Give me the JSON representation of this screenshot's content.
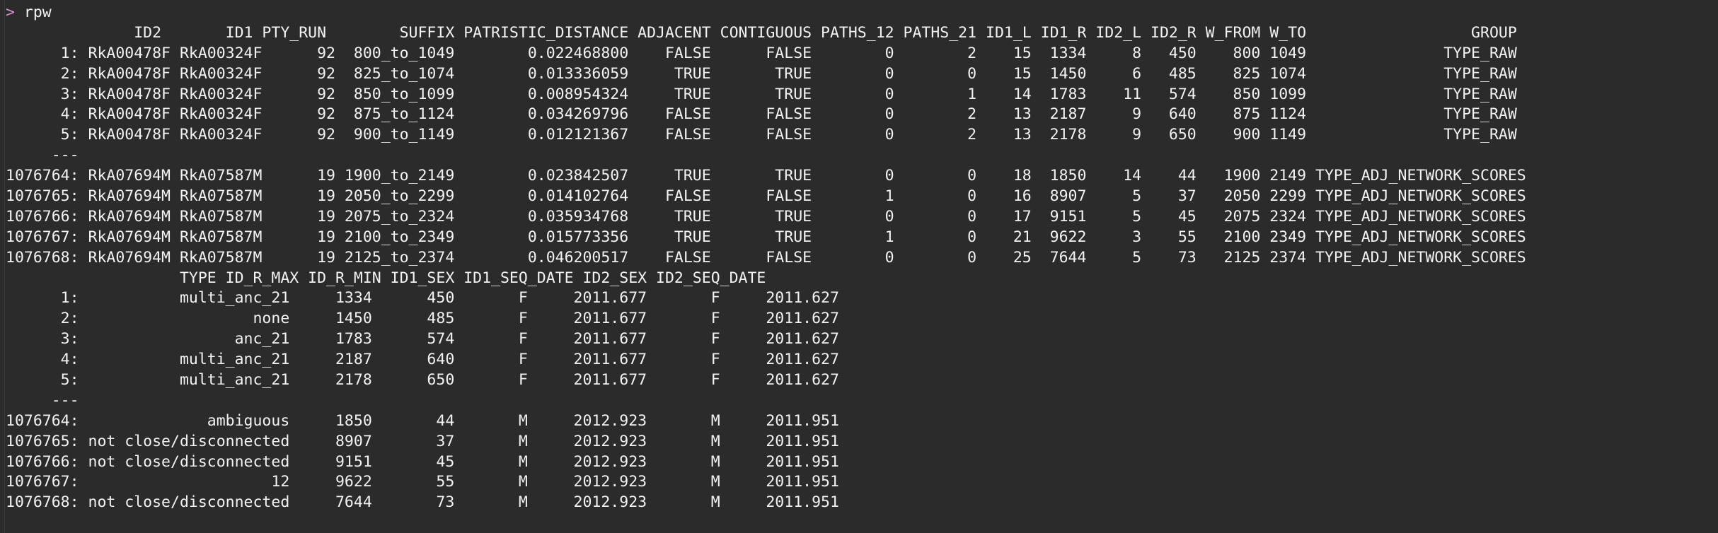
{
  "terminal": {
    "prompt_symbol": ">",
    "command": "rpw",
    "separator": "---",
    "colors": {
      "background": "#2b2b2b",
      "text": "#f2f2f2",
      "prompt": "#d98fd0"
    }
  },
  "table_main": {
    "columns": [
      "ID2",
      "ID1",
      "PTY_RUN",
      "SUFFIX",
      "PATRISTIC_DISTANCE",
      "ADJACENT",
      "CONTIGUOUS",
      "PATHS_12",
      "PATHS_21",
      "ID1_L",
      "ID1_R",
      "ID2_L",
      "ID2_R",
      "W_FROM",
      "W_TO",
      "GROUP"
    ],
    "header_line": "              ID2        ID1 PTY_RUN        SUFFIX PATRISTIC_DISTANCE ADJACENT CONTIGUOUS PATHS_12 PATHS_21 ID1_L ID1_R ID2_L ID2_R W_FROM W_TO                  GROUP",
    "rows_top": [
      {
        "index": "1:",
        "ID2": "RkA00478F",
        "ID1": "RkA00324F",
        "PTY_RUN": "92",
        "SUFFIX": "800_to_1049",
        "PATRISTIC_DISTANCE": "0.022468800",
        "ADJACENT": "FALSE",
        "CONTIGUOUS": "FALSE",
        "PATHS_12": "0",
        "PATHS_21": "2",
        "ID1_L": "15",
        "ID1_R": "1334",
        "ID2_L": "8",
        "ID2_R": "450",
        "W_FROM": "800",
        "W_TO": "1049",
        "GROUP": "TYPE_RAW"
      },
      {
        "index": "2:",
        "ID2": "RkA00478F",
        "ID1": "RkA00324F",
        "PTY_RUN": "92",
        "SUFFIX": "825_to_1074",
        "PATRISTIC_DISTANCE": "0.013336059",
        "ADJACENT": "TRUE",
        "CONTIGUOUS": "TRUE",
        "PATHS_12": "0",
        "PATHS_21": "0",
        "ID1_L": "15",
        "ID1_R": "1450",
        "ID2_L": "6",
        "ID2_R": "485",
        "W_FROM": "825",
        "W_TO": "1074",
        "GROUP": "TYPE_RAW"
      },
      {
        "index": "3:",
        "ID2": "RkA00478F",
        "ID1": "RkA00324F",
        "PTY_RUN": "92",
        "SUFFIX": "850_to_1099",
        "PATRISTIC_DISTANCE": "0.008954324",
        "ADJACENT": "TRUE",
        "CONTIGUOUS": "TRUE",
        "PATHS_12": "0",
        "PATHS_21": "1",
        "ID1_L": "14",
        "ID1_R": "1783",
        "ID2_L": "11",
        "ID2_R": "574",
        "W_FROM": "850",
        "W_TO": "1099",
        "GROUP": "TYPE_RAW"
      },
      {
        "index": "4:",
        "ID2": "RkA00478F",
        "ID1": "RkA00324F",
        "PTY_RUN": "92",
        "SUFFIX": "875_to_1124",
        "PATRISTIC_DISTANCE": "0.034269796",
        "ADJACENT": "FALSE",
        "CONTIGUOUS": "FALSE",
        "PATHS_12": "0",
        "PATHS_21": "2",
        "ID1_L": "13",
        "ID1_R": "2187",
        "ID2_L": "9",
        "ID2_R": "640",
        "W_FROM": "875",
        "W_TO": "1124",
        "GROUP": "TYPE_RAW"
      },
      {
        "index": "5:",
        "ID2": "RkA00478F",
        "ID1": "RkA00324F",
        "PTY_RUN": "92",
        "SUFFIX": "900_to_1149",
        "PATRISTIC_DISTANCE": "0.012121367",
        "ADJACENT": "FALSE",
        "CONTIGUOUS": "FALSE",
        "PATHS_12": "0",
        "PATHS_21": "2",
        "ID1_L": "13",
        "ID1_R": "2178",
        "ID2_L": "9",
        "ID2_R": "650",
        "W_FROM": "900",
        "W_TO": "1149",
        "GROUP": "TYPE_RAW"
      }
    ],
    "rows_bottom": [
      {
        "index": "1076764:",
        "ID2": "RkA07694M",
        "ID1": "RkA07587M",
        "PTY_RUN": "19",
        "SUFFIX": "1900_to_2149",
        "PATRISTIC_DISTANCE": "0.023842507",
        "ADJACENT": "TRUE",
        "CONTIGUOUS": "TRUE",
        "PATHS_12": "0",
        "PATHS_21": "0",
        "ID1_L": "18",
        "ID1_R": "1850",
        "ID2_L": "14",
        "ID2_R": "44",
        "W_FROM": "1900",
        "W_TO": "2149",
        "GROUP": "TYPE_ADJ_NETWORK_SCORES"
      },
      {
        "index": "1076765:",
        "ID2": "RkA07694M",
        "ID1": "RkA07587M",
        "PTY_RUN": "19",
        "SUFFIX": "2050_to_2299",
        "PATRISTIC_DISTANCE": "0.014102764",
        "ADJACENT": "FALSE",
        "CONTIGUOUS": "FALSE",
        "PATHS_12": "1",
        "PATHS_21": "0",
        "ID1_L": "16",
        "ID1_R": "8907",
        "ID2_L": "5",
        "ID2_R": "37",
        "W_FROM": "2050",
        "W_TO": "2299",
        "GROUP": "TYPE_ADJ_NETWORK_SCORES"
      },
      {
        "index": "1076766:",
        "ID2": "RkA07694M",
        "ID1": "RkA07587M",
        "PTY_RUN": "19",
        "SUFFIX": "2075_to_2324",
        "PATRISTIC_DISTANCE": "0.035934768",
        "ADJACENT": "TRUE",
        "CONTIGUOUS": "TRUE",
        "PATHS_12": "0",
        "PATHS_21": "0",
        "ID1_L": "17",
        "ID1_R": "9151",
        "ID2_L": "5",
        "ID2_R": "45",
        "W_FROM": "2075",
        "W_TO": "2324",
        "GROUP": "TYPE_ADJ_NETWORK_SCORES"
      },
      {
        "index": "1076767:",
        "ID2": "RkA07694M",
        "ID1": "RkA07587M",
        "PTY_RUN": "19",
        "SUFFIX": "2100_to_2349",
        "PATRISTIC_DISTANCE": "0.015773356",
        "ADJACENT": "TRUE",
        "CONTIGUOUS": "TRUE",
        "PATHS_12": "1",
        "PATHS_21": "0",
        "ID1_L": "21",
        "ID1_R": "9622",
        "ID2_L": "3",
        "ID2_R": "55",
        "W_FROM": "2100",
        "W_TO": "2349",
        "GROUP": "TYPE_ADJ_NETWORK_SCORES"
      },
      {
        "index": "1076768:",
        "ID2": "RkA07694M",
        "ID1": "RkA07587M",
        "PTY_RUN": "19",
        "SUFFIX": "2125_to_2374",
        "PATRISTIC_DISTANCE": "0.046200517",
        "ADJACENT": "FALSE",
        "CONTIGUOUS": "FALSE",
        "PATHS_12": "0",
        "PATHS_21": "0",
        "ID1_L": "25",
        "ID1_R": "7644",
        "ID2_L": "5",
        "ID2_R": "73",
        "W_FROM": "2125",
        "W_TO": "2374",
        "GROUP": "TYPE_ADJ_NETWORK_SCORES"
      }
    ]
  },
  "table_cont": {
    "columns": [
      "TYPE",
      "ID_R_MAX",
      "ID_R_MIN",
      "ID1_SEX",
      "ID1_SEQ_DATE",
      "ID2_SEX",
      "ID2_SEQ_DATE"
    ],
    "header_line": "                    TYPE ID_R_MAX ID_R_MIN ID1_SEX ID1_SEQ_DATE ID2_SEX ID2_SEQ_DATE",
    "rows_top": [
      {
        "index": "1:",
        "TYPE": "multi_anc_21",
        "ID_R_MAX": "1334",
        "ID_R_MIN": "450",
        "ID1_SEX": "F",
        "ID1_SEQ_DATE": "2011.677",
        "ID2_SEX": "F",
        "ID2_SEQ_DATE": "2011.627"
      },
      {
        "index": "2:",
        "TYPE": "none",
        "ID_R_MAX": "1450",
        "ID_R_MIN": "485",
        "ID1_SEX": "F",
        "ID1_SEQ_DATE": "2011.677",
        "ID2_SEX": "F",
        "ID2_SEQ_DATE": "2011.627"
      },
      {
        "index": "3:",
        "TYPE": "anc_21",
        "ID_R_MAX": "1783",
        "ID_R_MIN": "574",
        "ID1_SEX": "F",
        "ID1_SEQ_DATE": "2011.677",
        "ID2_SEX": "F",
        "ID2_SEQ_DATE": "2011.627"
      },
      {
        "index": "4:",
        "TYPE": "multi_anc_21",
        "ID_R_MAX": "2187",
        "ID_R_MIN": "640",
        "ID1_SEX": "F",
        "ID1_SEQ_DATE": "2011.677",
        "ID2_SEX": "F",
        "ID2_SEQ_DATE": "2011.627"
      },
      {
        "index": "5:",
        "TYPE": "multi_anc_21",
        "ID_R_MAX": "2178",
        "ID_R_MIN": "650",
        "ID1_SEX": "F",
        "ID1_SEQ_DATE": "2011.677",
        "ID2_SEX": "F",
        "ID2_SEQ_DATE": "2011.627"
      }
    ],
    "rows_bottom": [
      {
        "index": "1076764:",
        "TYPE": "ambiguous",
        "ID_R_MAX": "1850",
        "ID_R_MIN": "44",
        "ID1_SEX": "M",
        "ID1_SEQ_DATE": "2012.923",
        "ID2_SEX": "M",
        "ID2_SEQ_DATE": "2011.951"
      },
      {
        "index": "1076765:",
        "TYPE": "not close/disconnected",
        "ID_R_MAX": "8907",
        "ID_R_MIN": "37",
        "ID1_SEX": "M",
        "ID1_SEQ_DATE": "2012.923",
        "ID2_SEX": "M",
        "ID2_SEQ_DATE": "2011.951"
      },
      {
        "index": "1076766:",
        "TYPE": "not close/disconnected",
        "ID_R_MAX": "9151",
        "ID_R_MIN": "45",
        "ID1_SEX": "M",
        "ID1_SEQ_DATE": "2012.923",
        "ID2_SEX": "M",
        "ID2_SEQ_DATE": "2011.951"
      },
      {
        "index": "1076767:",
        "TYPE": "12",
        "ID_R_MAX": "9622",
        "ID_R_MIN": "55",
        "ID1_SEX": "M",
        "ID1_SEQ_DATE": "2012.923",
        "ID2_SEX": "M",
        "ID2_SEQ_DATE": "2011.951"
      },
      {
        "index": "1076768:",
        "TYPE": "not close/disconnected",
        "ID_R_MAX": "7644",
        "ID_R_MIN": "73",
        "ID1_SEX": "M",
        "ID1_SEQ_DATE": "2012.923",
        "ID2_SEX": "M",
        "ID2_SEQ_DATE": "2011.951"
      }
    ]
  },
  "lines": {
    "l00_prompt": "rpw",
    "l01_header": "              ID2       ID1 PTY_RUN        SUFFIX PATRISTIC_DISTANCE ADJACENT CONTIGUOUS PATHS_12 PATHS_21 ID1_L ID1_R ID2_L ID2_R W_FROM W_TO                  GROUP",
    "l02": "      1: RkA00478F RkA00324F      92  800_to_1049        0.022468800    FALSE      FALSE        0        2    15  1334     8   450    800 1049               TYPE_RAW",
    "l03": "      2: RkA00478F RkA00324F      92  825_to_1074        0.013336059     TRUE       TRUE        0        0    15  1450     6   485    825 1074               TYPE_RAW",
    "l04": "      3: RkA00478F RkA00324F      92  850_to_1099        0.008954324     TRUE       TRUE        0        1    14  1783    11   574    850 1099               TYPE_RAW",
    "l05": "      4: RkA00478F RkA00324F      92  875_to_1124        0.034269796    FALSE      FALSE        0        2    13  2187     9   640    875 1124               TYPE_RAW",
    "l06": "      5: RkA00478F RkA00324F      92  900_to_1149        0.012121367    FALSE      FALSE        0        2    13  2178     9   650    900 1149               TYPE_RAW",
    "l07_sep": "     ---",
    "l08": "1076764: RkA07694M RkA07587M      19 1900_to_2149        0.023842507     TRUE       TRUE        0        0    18  1850    14    44   1900 2149 TYPE_ADJ_NETWORK_SCORES",
    "l09": "1076765: RkA07694M RkA07587M      19 2050_to_2299        0.014102764    FALSE      FALSE        1        0    16  8907     5    37   2050 2299 TYPE_ADJ_NETWORK_SCORES",
    "l10": "1076766: RkA07694M RkA07587M      19 2075_to_2324        0.035934768     TRUE       TRUE        0        0    17  9151     5    45   2075 2324 TYPE_ADJ_NETWORK_SCORES",
    "l11": "1076767: RkA07694M RkA07587M      19 2100_to_2349        0.015773356     TRUE       TRUE        1        0    21  9622     3    55   2100 2349 TYPE_ADJ_NETWORK_SCORES",
    "l12": "1076768: RkA07694M RkA07587M      19 2125_to_2374        0.046200517    FALSE      FALSE        0        0    25  7644     5    73   2125 2374 TYPE_ADJ_NETWORK_SCORES",
    "l13_header2": "                   TYPE ID_R_MAX ID_R_MIN ID1_SEX ID1_SEQ_DATE ID2_SEX ID2_SEQ_DATE",
    "l14": "      1:           multi_anc_21     1334      450       F     2011.677       F     2011.627",
    "l15": "      2:                   none     1450      485       F     2011.677       F     2011.627",
    "l16": "      3:                 anc_21     1783      574       F     2011.677       F     2011.627",
    "l17": "      4:           multi_anc_21     2187      640       F     2011.677       F     2011.627",
    "l18": "      5:           multi_anc_21     2178      650       F     2011.677       F     2011.627",
    "l19_sep": "     ---",
    "l20": "1076764:              ambiguous     1850       44       M     2012.923       M     2011.951",
    "l21": "1076765: not close/disconnected     8907       37       M     2012.923       M     2011.951",
    "l22": "1076766: not close/disconnected     9151       45       M     2012.923       M     2011.951",
    "l23": "1076767:                     12     9622       55       M     2012.923       M     2011.951",
    "l24": "1076768: not close/disconnected     7644       73       M     2012.923       M     2011.951"
  }
}
